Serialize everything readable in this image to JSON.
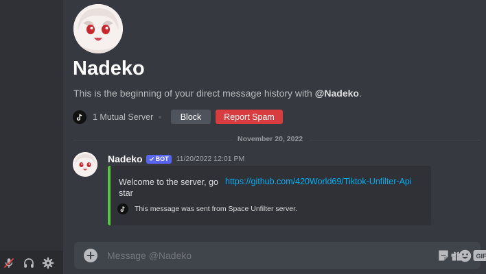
{
  "dm": {
    "name": "Nadeko",
    "intro_prefix": "This is the beginning of your direct message history with ",
    "intro_mention": "@Nadeko",
    "intro_suffix": ".",
    "mutual_servers": "1 Mutual Server",
    "block_label": "Block",
    "report_label": "Report Spam"
  },
  "divider": {
    "date": "November 20, 2022"
  },
  "message": {
    "author": "Nadeko",
    "bot_tag": "BOT",
    "timestamp": "11/20/2022 12:01 PM",
    "embed": {
      "text": "Welcome to the server, go star",
      "link": "https://github.com/420World69/Tiktok-Unfilter-Api",
      "footer": "This message was sent from Space Unfilter server.",
      "border_color": "#57c53f"
    }
  },
  "composer": {
    "placeholder": "Message @Nadeko",
    "gif_label": "GIF"
  },
  "icons": {
    "user_bar": [
      "mute-mic-icon",
      "headphones-icon",
      "settings-gear-icon"
    ],
    "composer": [
      "add-plus-icon",
      "gift-icon",
      "gif-icon",
      "sticker-icon",
      "emoji-icon"
    ],
    "mutual": "tiktok-icon"
  },
  "colors": {
    "accent": "#5865f2",
    "danger": "#d83c3e",
    "link": "#00aff4",
    "background": "#36393f",
    "sidebar": "#2f3136"
  }
}
